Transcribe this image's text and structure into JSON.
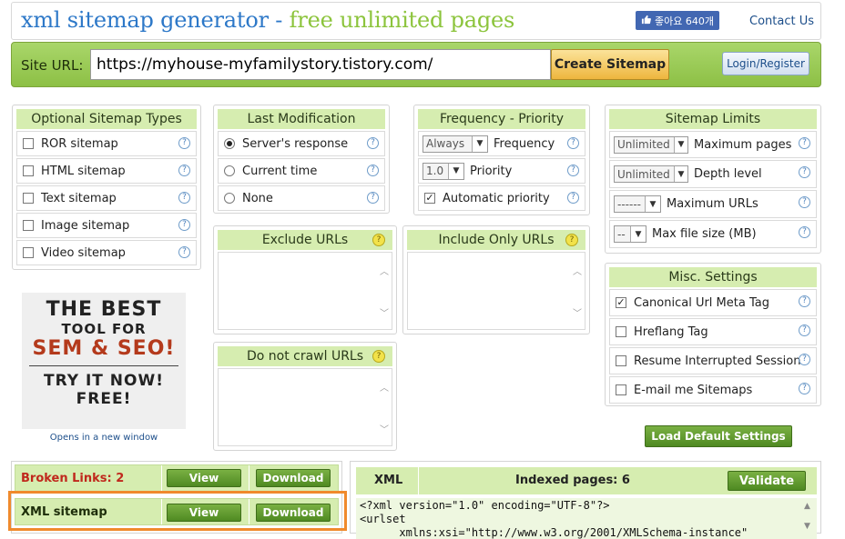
{
  "header": {
    "title_part1": "xml sitemap generator -",
    "title_part2": "free unlimited pages",
    "like_label": "좋아요 640개",
    "contact": "Contact Us"
  },
  "urlbar": {
    "label": "Site URL:",
    "value": "https://myhouse-myfamilystory.tistory.com/",
    "create_button": "Create Sitemap",
    "login_button": "Login/Register"
  },
  "optional_types": {
    "title": "Optional Sitemap Types",
    "items": [
      {
        "label": "ROR sitemap",
        "checked": false
      },
      {
        "label": "HTML sitemap",
        "checked": false
      },
      {
        "label": "Text sitemap",
        "checked": false
      },
      {
        "label": "Image sitemap",
        "checked": false
      },
      {
        "label": "Video sitemap",
        "checked": false
      }
    ]
  },
  "last_mod": {
    "title": "Last Modification",
    "options": [
      {
        "label": "Server's response",
        "selected": true
      },
      {
        "label": "Current time",
        "selected": false
      },
      {
        "label": "None",
        "selected": false
      }
    ]
  },
  "freq": {
    "title": "Frequency - Priority",
    "frequency_value": "Always",
    "frequency_label": "Frequency",
    "priority_value": "1.0",
    "priority_label": "Priority",
    "auto_label": "Automatic priority",
    "auto_checked": true
  },
  "limits": {
    "title": "Sitemap Limits",
    "max_pages_value": "Unlimited",
    "max_pages_label": "Maximum pages",
    "depth_value": "Unlimited",
    "depth_label": "Depth level",
    "max_urls_value": "------",
    "max_urls_label": "Maximum URLs",
    "max_size_value": "--",
    "max_size_label": "Max file size (MB)"
  },
  "exclude": {
    "title": "Exclude URLs"
  },
  "include": {
    "title": "Include Only URLs"
  },
  "nocrawl": {
    "title": "Do not crawl URLs"
  },
  "misc": {
    "title": "Misc. Settings",
    "items": [
      {
        "label": "Canonical Url Meta Tag",
        "checked": true
      },
      {
        "label": "Hreflang Tag",
        "checked": false
      },
      {
        "label": "Resume Interrupted Session",
        "checked": false
      },
      {
        "label": "E-mail me Sitemaps",
        "checked": false
      }
    ]
  },
  "load_default": "Load Default Settings",
  "promo": {
    "line1": "THE BEST",
    "line2": "TOOL FOR",
    "line3": "SEM & SEO!",
    "line4": "TRY IT NOW!",
    "line5": "FREE!",
    "opens": "Opens in a new window"
  },
  "results": {
    "broken_label": "Broken Links: 2",
    "xml_label": "XML sitemap",
    "view": "View",
    "download": "Download"
  },
  "xml": {
    "tab": "XML",
    "indexed": "Indexed pages: 6",
    "validate": "Validate",
    "code_line1": "<?xml version=\"1.0\" encoding=\"UTF-8\"?>",
    "code_line2": "<urlset",
    "code_line3": "      xmlns:xsi=\"http://www.w3.org/2001/XMLSchema-instance\""
  },
  "colors": {
    "title_blue": "#2d78c8",
    "title_green": "#8cc43c",
    "panel_head": "#d6edb0",
    "highlight_orange": "#f08a2c",
    "button_green": "#4f8a22"
  }
}
